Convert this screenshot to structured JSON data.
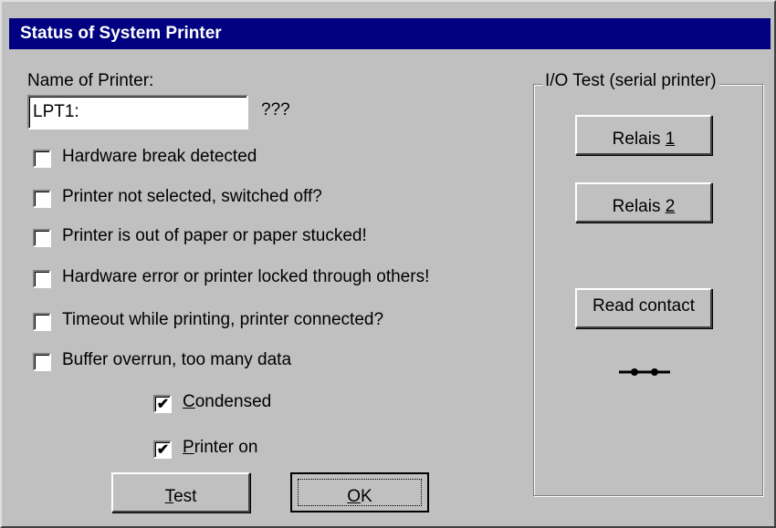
{
  "window": {
    "title": "Status of System Printer"
  },
  "printer": {
    "name_label": "Name of Printer:",
    "name_value": "LPT1:",
    "status_text": "???"
  },
  "status_flags": [
    {
      "label": "Hardware break detected",
      "checked": false
    },
    {
      "label": "Printer not selected, switched off?",
      "checked": false
    },
    {
      "label": "Printer is out of paper or paper stucked!",
      "checked": false
    },
    {
      "label": "Hardware error or printer locked through others!",
      "checked": false
    },
    {
      "label": "Timeout while printing, printer connected?",
      "checked": false
    },
    {
      "label": "Buffer overrun, too many data",
      "checked": false
    }
  ],
  "options": {
    "condensed": {
      "label_first": "C",
      "label_rest": "ondensed",
      "checked": true
    },
    "printer_on": {
      "label_first": "P",
      "label_rest": "rinter on",
      "checked": true
    }
  },
  "buttons": {
    "test": {
      "accel": "T",
      "rest": "est"
    },
    "ok": {
      "accel": "O",
      "rest": "K"
    }
  },
  "io_test": {
    "group_title": "I/O Test (serial printer)",
    "relais1": {
      "prefix": "Relais ",
      "accel": "1"
    },
    "relais2": {
      "prefix": "Relais ",
      "accel": "2"
    },
    "read_contact": "Read contact",
    "contact_icon": "contact-closed-icon"
  },
  "colors": {
    "dialog_bg": "#c0c0c0",
    "title_bg": "#000080",
    "title_fg": "#ffffff"
  }
}
